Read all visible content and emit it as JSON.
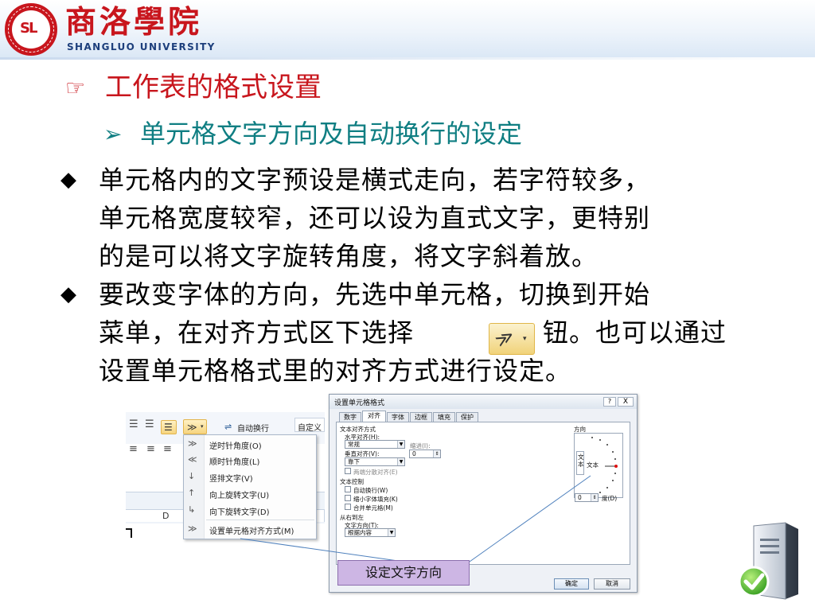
{
  "header": {
    "university_cn": "商洛學院",
    "university_en": "SHANGLUO UNIVERSITY",
    "seal_mark": "SL",
    "brand_color": "#c8161d",
    "seal_icon": "university-seal-icon"
  },
  "slide": {
    "heading1": "工作表的格式设置",
    "heading1_icon": "pointing-hand-icon",
    "heading2": "单元格文字方向及自动换行的设定",
    "heading2_icon": "arrow-bullet-icon",
    "heading1_color": "#c8161d",
    "heading2_color": "#0f7e82",
    "bullets": [
      {
        "lines": [
          "单元格内的文字预设是横式走向，若字符较多，",
          "单元格宽度较窄，还可以设为直式文字，更特别",
          "的是可以将文字旋转角度，将文字斜着放。"
        ]
      },
      {
        "lines": [
          "要改变字体的方向，先选中单元格，切换到开始",
          "菜单，在对齐方式区下选择",
          "钮。也可以通过",
          "设置单元格格式里的对齐方式进行设定。"
        ]
      }
    ],
    "bullet_icon": "diamond-bullet-icon",
    "inline_icon": "text-orientation-icon"
  },
  "ribbon": {
    "wrap_text": "自动换行",
    "custom": "自定义",
    "column_d": "D"
  },
  "orientation_menu": {
    "items": [
      {
        "label": "逆时针角度(O)",
        "icon": "angle-counterclockwise-icon"
      },
      {
        "label": "顺时针角度(L)",
        "icon": "angle-clockwise-icon"
      },
      {
        "label": "竖排文字(V)",
        "icon": "vertical-text-icon"
      },
      {
        "label": "向上旋转文字(U)",
        "icon": "rotate-text-up-icon"
      },
      {
        "label": "向下旋转文字(D)",
        "icon": "rotate-text-down-icon"
      },
      {
        "label": "设置单元格对齐方式(M)",
        "icon": "format-alignment-icon"
      }
    ]
  },
  "format_dialog": {
    "title": "设置单元格格式",
    "help": "?",
    "close": "X",
    "tabs": [
      "数字",
      "对齐",
      "字体",
      "边框",
      "填充",
      "保护"
    ],
    "active_tab": "对齐",
    "text_alignment": "文本对齐方式",
    "horizontal_label": "水平对齐(H):",
    "horizontal_value": "常规",
    "indent_label": "缩进(I):",
    "indent_value": "0",
    "vertical_label": "垂直对齐(V):",
    "vertical_value": "靠下",
    "justify_distributed": "两端分散对齐(E)",
    "text_control": "文本控制",
    "wrap_text": "自动换行(W)",
    "shrink_to_fit": "缩小字体填充(K)",
    "merge_cells": "合并单元格(M)",
    "rtl": "从右到左",
    "text_direction_label": "文字方向(T):",
    "text_direction_value": "根据内容",
    "orientation": "方向",
    "vertical_text": "文本",
    "horizontal_text": "文本",
    "degrees_value": "0",
    "degrees_label": "度(D)",
    "ok": "确定",
    "cancel": "取消"
  },
  "callout": {
    "label": "设定文字方向",
    "fill": "#cdb6e4"
  },
  "decor": {
    "server_icon": "server-check-icon"
  }
}
